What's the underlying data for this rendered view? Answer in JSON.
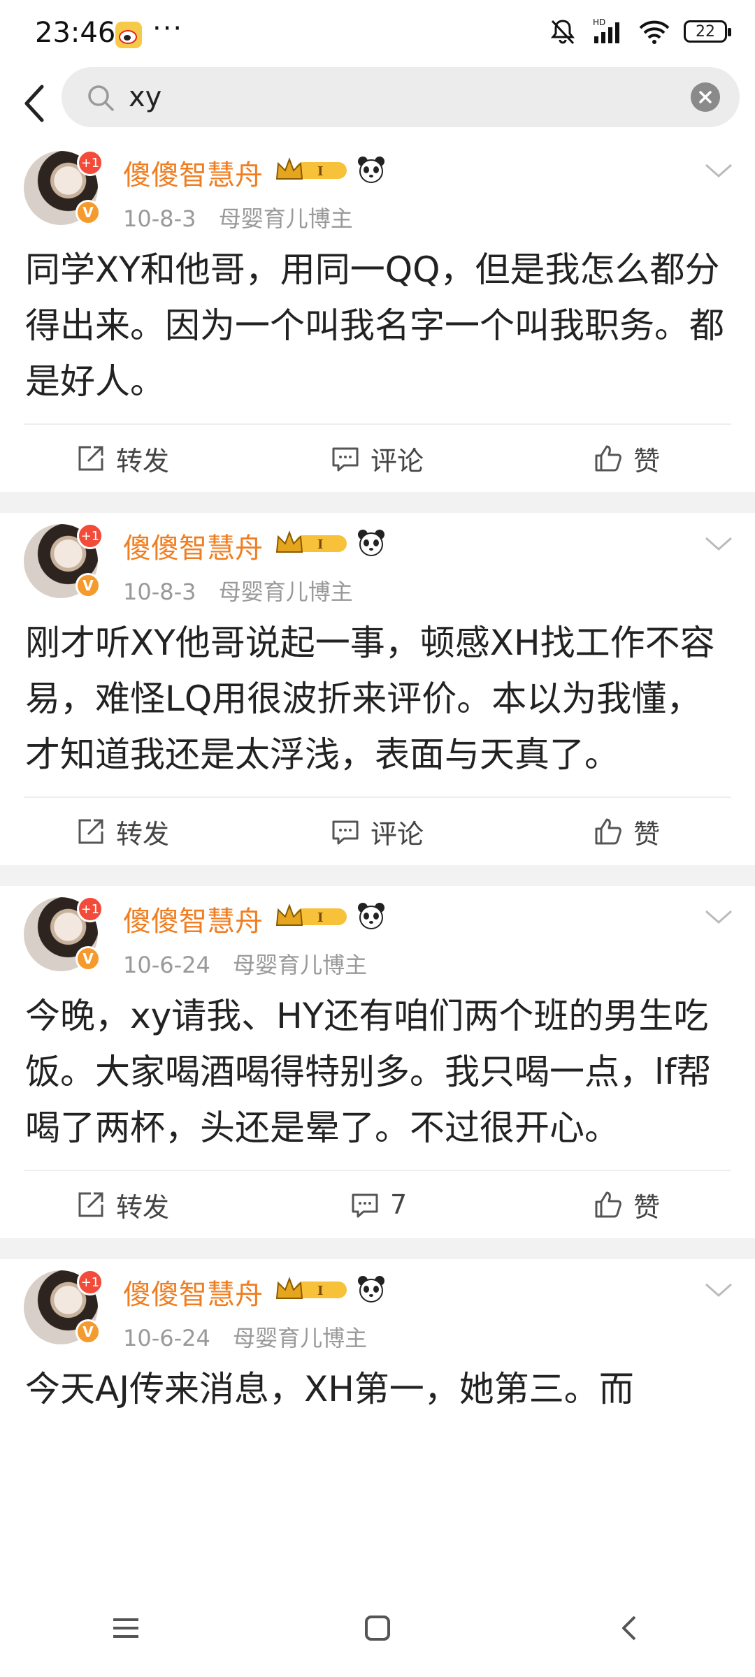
{
  "status_bar": {
    "time": "23:46",
    "more": "···",
    "battery": "22",
    "icons": [
      "weibo-icon",
      "mute-icon",
      "hd-signal-icon",
      "wifi-icon",
      "battery-icon"
    ]
  },
  "search": {
    "query": "xy",
    "back_icon": "back-arrow-icon",
    "search_icon": "search-icon",
    "clear_icon": "clear-icon"
  },
  "colors": {
    "username": "#f07e21",
    "meta": "#999999",
    "badge_red": "#f24b3a",
    "verify_orange": "#f59a2c"
  },
  "posts": [
    {
      "author": "傻傻智慧舟",
      "avatar_badge": "+1",
      "verified": "V",
      "date": "10-8-3",
      "tag": "母婴育儿博主",
      "text": "同学XY和他哥，用同一QQ，但是我怎么都分得出来。因为一个叫我名字一个叫我职务。都是好人。",
      "actions": {
        "repost": "转发",
        "comment": "评论",
        "like": "赞"
      }
    },
    {
      "author": "傻傻智慧舟",
      "avatar_badge": "+1",
      "verified": "V",
      "date": "10-8-3",
      "tag": "母婴育儿博主",
      "text": "刚才听XY他哥说起一事，顿感XH找工作不容易，难怪LQ用很波折来评价。本以为我懂，才知道我还是太浮浅，表面与天真了。",
      "actions": {
        "repost": "转发",
        "comment": "评论",
        "like": "赞"
      }
    },
    {
      "author": "傻傻智慧舟",
      "avatar_badge": "+1",
      "verified": "V",
      "date": "10-6-24",
      "tag": "母婴育儿博主",
      "text": "今晚，xy请我、HY还有咱们两个班的男生吃饭。大家喝酒喝得特别多。我只喝一点，lf帮喝了两杯，头还是晕了。不过很开心。",
      "actions": {
        "repost": "转发",
        "comment": "7",
        "like": "赞"
      }
    },
    {
      "author": "傻傻智慧舟",
      "avatar_badge": "+1",
      "verified": "V",
      "date": "10-6-24",
      "tag": "母婴育儿博主",
      "text": "今天AJ传来消息，XH第一，她第三。而"
    }
  ],
  "nav_bar": {
    "icons": [
      "menu-icon",
      "home-icon",
      "back-icon"
    ]
  }
}
